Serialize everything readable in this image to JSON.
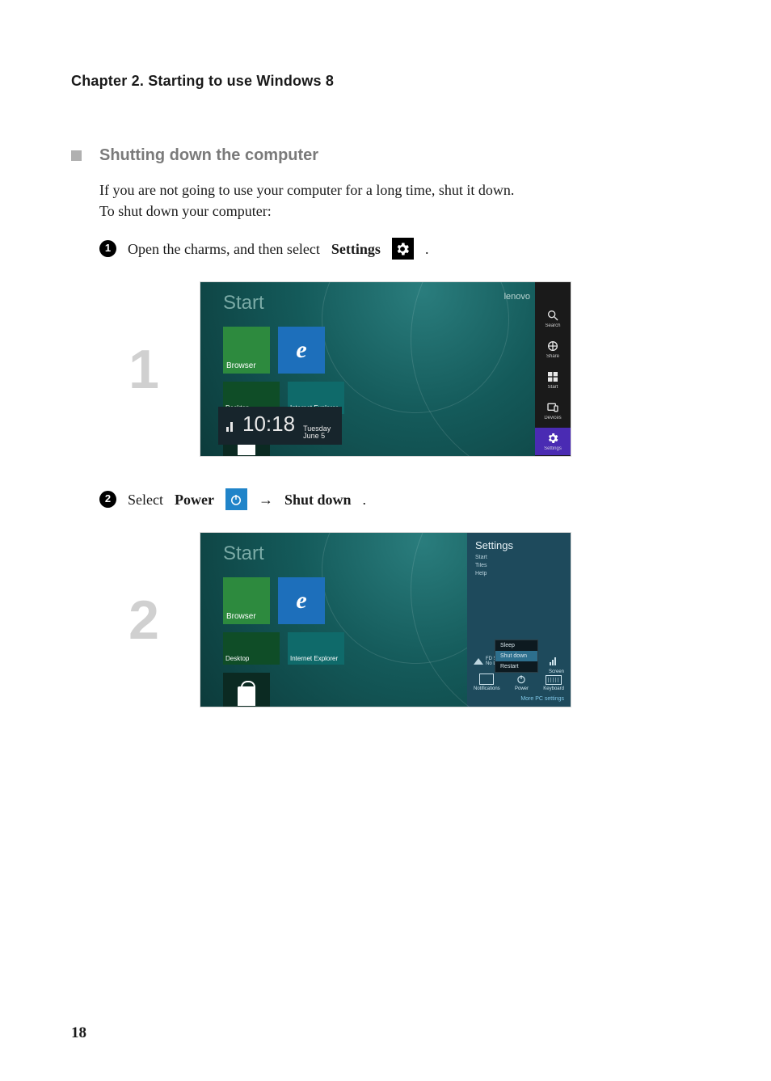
{
  "chapter_title": "Chapter 2. Starting to use Windows 8",
  "section_title": "Shutting down the computer",
  "intro_line1": "If you are not going to use your computer for a long time, shut it down.",
  "intro_line2": "To shut down your computer:",
  "steps": {
    "s1_pre": "Open the charms, and then select ",
    "s1_bold": "Settings",
    "s1_post": " .",
    "s2_a": "Select ",
    "s2_power": "Power",
    "s2_arrow": " → ",
    "s2_shut": "Shut down",
    "s2_end": "."
  },
  "figure_numbers": {
    "one": "1",
    "two": "2"
  },
  "screenshot": {
    "start_label": "Start",
    "brand": "lenovo",
    "tile_browser": "Browser",
    "tile_desktop": "Desktop",
    "tile_ie_sub": "Internet Explorer",
    "tile_store": "Store",
    "clock_time": "10:18",
    "clock_day": "Tuesday",
    "clock_date": "June 5",
    "charms": {
      "search": "Search",
      "share": "Share",
      "start": "Start",
      "devices": "Devices",
      "settings": "Settings"
    },
    "flyout": {
      "title": "Settings",
      "link_start": "Start",
      "link_tiles": "Tiles",
      "link_help": "Help",
      "net_name": "FD Secure",
      "net_sub": "No LTE",
      "vol_label": "Screen",
      "power_menu": {
        "sleep": "Sleep",
        "shut_down": "Shut down",
        "restart": "Restart"
      },
      "icon_notifications": "Notifications",
      "icon_power": "Power",
      "icon_keyboard": "Keyboard",
      "change": "More PC settings"
    }
  },
  "page_number": "18"
}
